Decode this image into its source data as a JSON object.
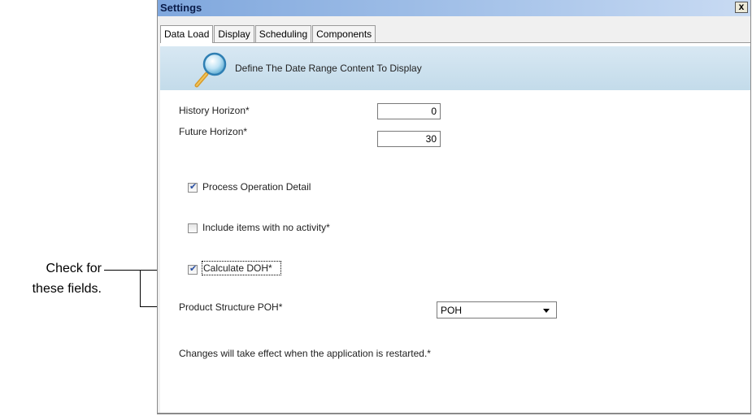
{
  "window": {
    "title": "Settings",
    "close_glyph": "x"
  },
  "tabs": [
    {
      "label": "Data Load"
    },
    {
      "label": "Display"
    },
    {
      "label": "Scheduling"
    },
    {
      "label": "Components"
    }
  ],
  "banner": {
    "text": "Define The Date Range Content To Display",
    "icon": "magnifier-icon"
  },
  "fields": {
    "history_label": "History Horizon*",
    "history_value": "0",
    "future_label": "Future Horizon*",
    "future_value": "30"
  },
  "checkboxes": {
    "process_label": "Process Operation Detail",
    "process_checked": true,
    "noactivity_label": "Include items with no activity*",
    "noactivity_checked": false,
    "doh_label": "Calculate DOH*",
    "doh_checked": true
  },
  "product_structure": {
    "label": "Product Structure POH*",
    "selected": "POH"
  },
  "note": "Changes will take effect when the application is restarted.*",
  "callout": {
    "line1": "Check for",
    "line2": "these fields."
  },
  "colors": {
    "titlebar": "#7fa7dd",
    "banner": "#c3dbea",
    "check": "#2a50a3"
  }
}
